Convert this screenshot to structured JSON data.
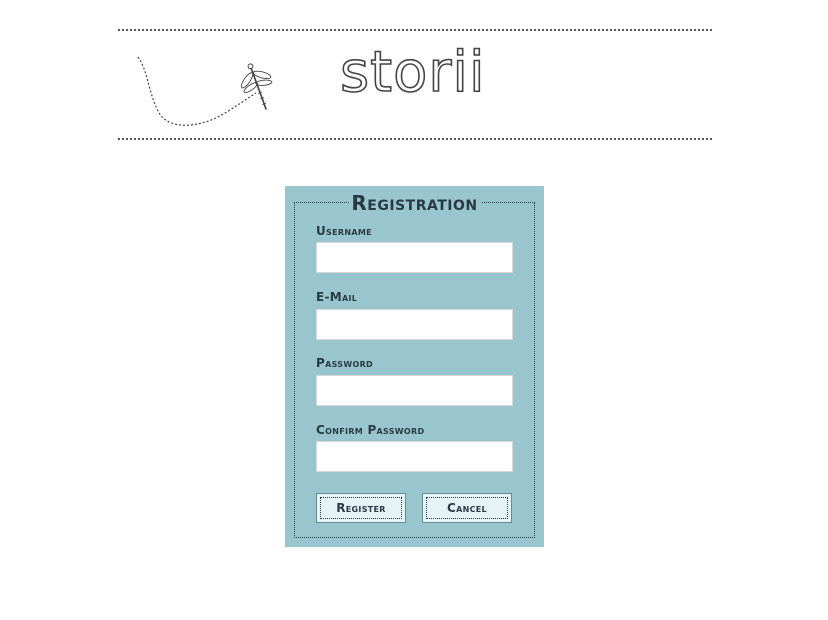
{
  "header": {
    "logo_text": "storii",
    "logo_icon": "dragonfly-icon"
  },
  "form": {
    "title": "Registration",
    "fields": [
      {
        "label": "Username",
        "value": "",
        "placeholder": ""
      },
      {
        "label": "E-Mail",
        "value": "",
        "placeholder": ""
      },
      {
        "label": "Password",
        "value": "",
        "placeholder": ""
      },
      {
        "label": "Confirm Password",
        "value": "",
        "placeholder": ""
      }
    ],
    "register_label": "Register",
    "cancel_label": "Cancel"
  },
  "colors": {
    "panel_background": "#98c5ce",
    "text_dark": "#2a3a44",
    "button_background": "#e4f3f6"
  }
}
